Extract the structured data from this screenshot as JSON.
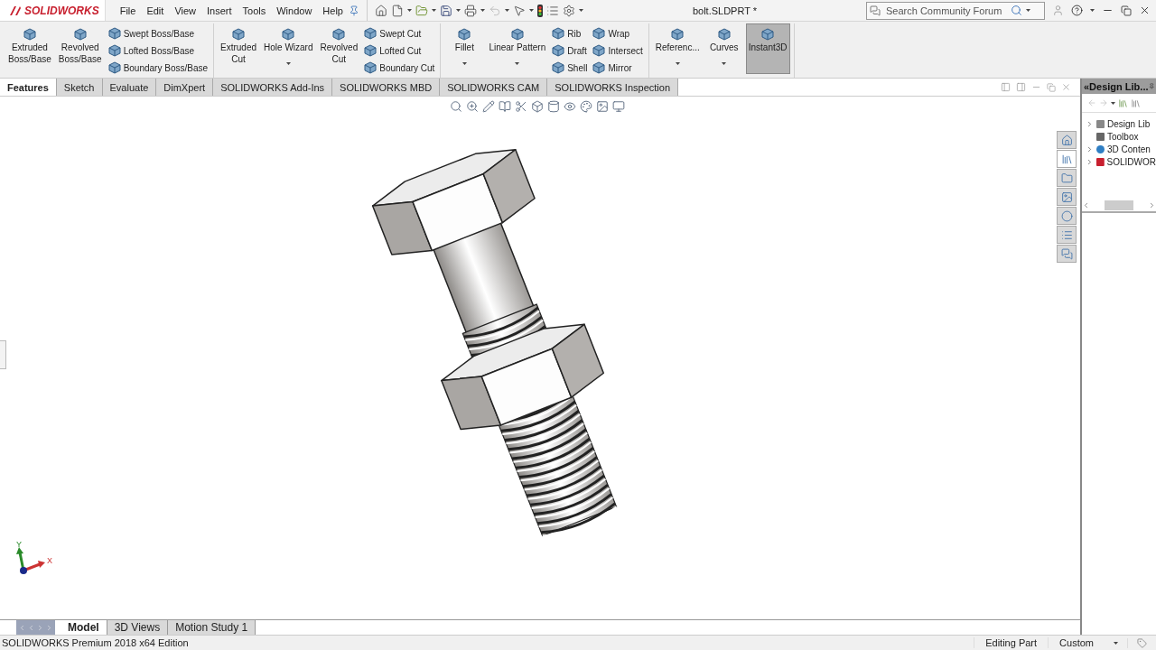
{
  "app": {
    "logo": "SOLIDWORKS",
    "menu": [
      "File",
      "Edit",
      "View",
      "Insert",
      "Tools",
      "Window",
      "Help"
    ],
    "title": "bolt.SLDPRT *",
    "search": {
      "placeholder": "Search Community Forum"
    }
  },
  "ribbon": {
    "groups": [
      {
        "items": [
          {
            "kind": "large",
            "label": "Extruded\nBoss/Base",
            "dropdown": false,
            "on": false
          },
          {
            "kind": "large",
            "label": "Revolved\nBoss/Base",
            "dropdown": false,
            "on": false
          },
          {
            "kind": "stack",
            "labels": [
              "Swept Boss/Base",
              "Lofted Boss/Base",
              "Boundary Boss/Base"
            ]
          }
        ]
      },
      {
        "items": [
          {
            "kind": "large",
            "label": "Extruded\nCut",
            "dropdown": false,
            "on": false
          },
          {
            "kind": "large",
            "label": "Hole Wizard",
            "dropdown": true,
            "on": false
          },
          {
            "kind": "large",
            "label": "Revolved\nCut",
            "dropdown": false,
            "on": false
          },
          {
            "kind": "stack",
            "labels": [
              "Swept Cut",
              "Lofted Cut",
              "Boundary Cut"
            ]
          }
        ]
      },
      {
        "items": [
          {
            "kind": "large",
            "label": "Fillet",
            "dropdown": true,
            "on": false
          },
          {
            "kind": "large",
            "label": "Linear Pattern",
            "dropdown": true,
            "on": false
          },
          {
            "kind": "stack",
            "labels": [
              "Rib",
              "Draft",
              "Shell"
            ]
          },
          {
            "kind": "stack",
            "labels": [
              "Wrap",
              "Intersect",
              "Mirror"
            ]
          }
        ]
      },
      {
        "items": [
          {
            "kind": "large",
            "label": "Referenc...",
            "dropdown": true,
            "on": false
          },
          {
            "kind": "large",
            "label": "Curves",
            "dropdown": true,
            "on": false
          },
          {
            "kind": "large",
            "label": "Instant3D",
            "dropdown": false,
            "on": true
          }
        ]
      }
    ]
  },
  "tabs": [
    {
      "label": "Features",
      "selected": true
    },
    {
      "label": "Sketch",
      "selected": false
    },
    {
      "label": "Evaluate",
      "selected": false
    },
    {
      "label": "DimXpert",
      "selected": false
    },
    {
      "label": "SOLIDWORKS Add-Ins",
      "selected": false
    },
    {
      "label": "SOLIDWORKS MBD",
      "selected": false
    },
    {
      "label": "SOLIDWORKS CAM",
      "selected": false
    },
    {
      "label": "SOLIDWORKS Inspection",
      "selected": false
    }
  ],
  "view": {
    "triad": {
      "x": "X",
      "y": "Y"
    }
  },
  "task_pane": {
    "title": "«Design Lib...",
    "tabs": [
      {
        "selected": false
      },
      {
        "selected": true
      },
      {
        "selected": false
      },
      {
        "selected": false
      },
      {
        "selected": false
      },
      {
        "selected": false
      },
      {
        "selected": false
      }
    ],
    "tree": [
      {
        "label": "Design Lib",
        "expandable": true
      },
      {
        "label": "Toolbox",
        "expandable": false
      },
      {
        "label": "3D Conten",
        "expandable": true
      },
      {
        "label": "SOLIDWOR",
        "expandable": true
      }
    ]
  },
  "bottom_tabs": [
    {
      "label": "Model",
      "selected": true
    },
    {
      "label": "3D Views",
      "selected": false
    },
    {
      "label": "Motion Study 1",
      "selected": false
    }
  ],
  "status_bar": {
    "product": "SOLIDWORKS Premium 2018 x64 Edition",
    "mode": "Editing Part",
    "units": "Custom"
  }
}
